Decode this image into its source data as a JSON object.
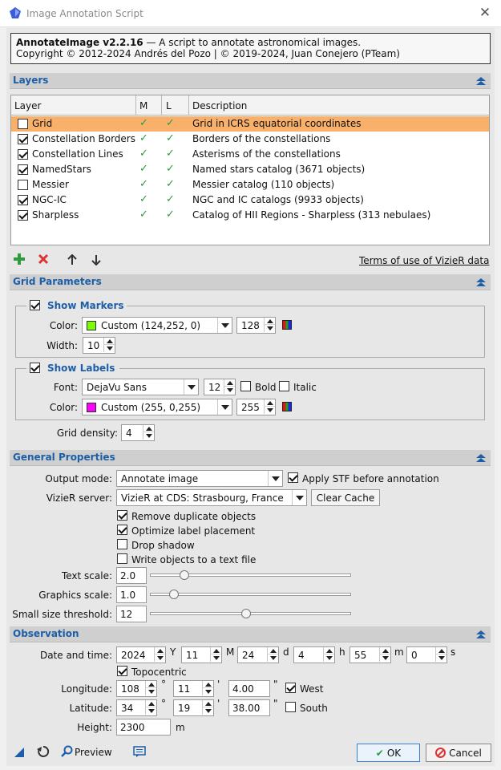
{
  "window": {
    "title": "Image Annotation Script"
  },
  "info": {
    "script_name": "AnnotateImage v2.2.16",
    "description": " — A script to annotate astronomical images.",
    "copyright": "Copyright © 2012-2024 Andrés del Pozo | © 2019-2024, Juan Conejero (PTeam)"
  },
  "sections": {
    "layers": "Layers",
    "grid": "Grid Parameters",
    "general": "General Properties",
    "observation": "Observation"
  },
  "layers": {
    "columns": [
      "Layer",
      "M",
      "L",
      "Description"
    ],
    "rows": [
      {
        "checked": false,
        "name": "Grid",
        "m": true,
        "l": true,
        "description": "Grid in ICRS equatorial coordinates",
        "selected": true
      },
      {
        "checked": true,
        "name": "Constellation Borders",
        "m": true,
        "l": true,
        "description": "Borders of the constellations",
        "selected": false
      },
      {
        "checked": true,
        "name": "Constellation Lines",
        "m": true,
        "l": true,
        "description": "Asterisms of the constellations",
        "selected": false
      },
      {
        "checked": true,
        "name": "NamedStars",
        "m": true,
        "l": true,
        "description": "Named stars catalog (3671 objects)",
        "selected": false
      },
      {
        "checked": false,
        "name": "Messier",
        "m": true,
        "l": true,
        "description": "Messier catalog (110 objects)",
        "selected": false
      },
      {
        "checked": true,
        "name": "NGC-IC",
        "m": true,
        "l": true,
        "description": "NGC and IC catalogs (9933 objects)",
        "selected": false
      },
      {
        "checked": true,
        "name": "Sharpless",
        "m": true,
        "l": true,
        "description": "Catalog of HII Regions - Sharpless (313 nebulaes)",
        "selected": false
      }
    ],
    "terms_link": "Terms of use of VizieR data"
  },
  "grid": {
    "markers": {
      "title": "Show Markers",
      "checked": true,
      "color_label": "Color:",
      "color_value": "Custom (124,252,  0)",
      "color_hex": "#7cfc00",
      "alpha": "128",
      "width_label": "Width:",
      "width": "10"
    },
    "labels": {
      "title": "Show Labels",
      "checked": true,
      "font_label": "Font:",
      "font_value": "DejaVu Sans",
      "size": "12",
      "bold_label": "Bold",
      "italic_label": "Italic",
      "color_label": "Color:",
      "color_value": "Custom (255,  0,255)",
      "color_hex": "#ff00ff",
      "alpha": "255"
    },
    "density_label": "Grid density:",
    "density": "4"
  },
  "general": {
    "output_mode_label": "Output mode:",
    "output_mode": "Annotate image",
    "apply_stf_label": "Apply STF before annotation",
    "vizier_label": "VizieR server:",
    "vizier_server": "VizieR at CDS: Strasbourg, France",
    "clear_cache": "Clear Cache",
    "options": [
      {
        "label": "Remove duplicate objects",
        "checked": true
      },
      {
        "label": "Optimize label placement",
        "checked": true
      },
      {
        "label": "Drop shadow",
        "checked": false
      },
      {
        "label": "Write objects to a text file",
        "checked": false
      }
    ],
    "text_scale_label": "Text scale:",
    "text_scale": "2.0",
    "text_scale_level": 0.17,
    "graphics_scale_label": "Graphics scale:",
    "graphics_scale": "1.0",
    "graphics_scale_level": 0.12,
    "threshold_label": "Small size threshold:",
    "threshold": "12",
    "threshold_level": 0.48
  },
  "observation": {
    "datetime_label": "Date and time:",
    "year": "2024",
    "year_unit": "Y",
    "month": "11",
    "month_unit": "M",
    "day": "24",
    "day_unit": "d",
    "hour": "4",
    "hour_unit": "h",
    "minute": "55",
    "minute_unit": "m",
    "second": "0",
    "second_unit": "s",
    "topocentric_label": "Topocentric",
    "longitude_label": "Longitude:",
    "lon_deg": "108",
    "lon_min": "11",
    "lon_sec": "4.00",
    "west_label": "West",
    "latitude_label": "Latitude:",
    "lat_deg": "34",
    "lat_min": "19",
    "lat_sec": "38.00",
    "south_label": "South",
    "height_label": "Height:",
    "height": "2300",
    "height_unit": "m",
    "deg_mark": "°",
    "min_mark": "'",
    "sec_mark": "\""
  },
  "footer": {
    "preview": "Preview",
    "ok": "OK",
    "cancel": "Cancel"
  }
}
